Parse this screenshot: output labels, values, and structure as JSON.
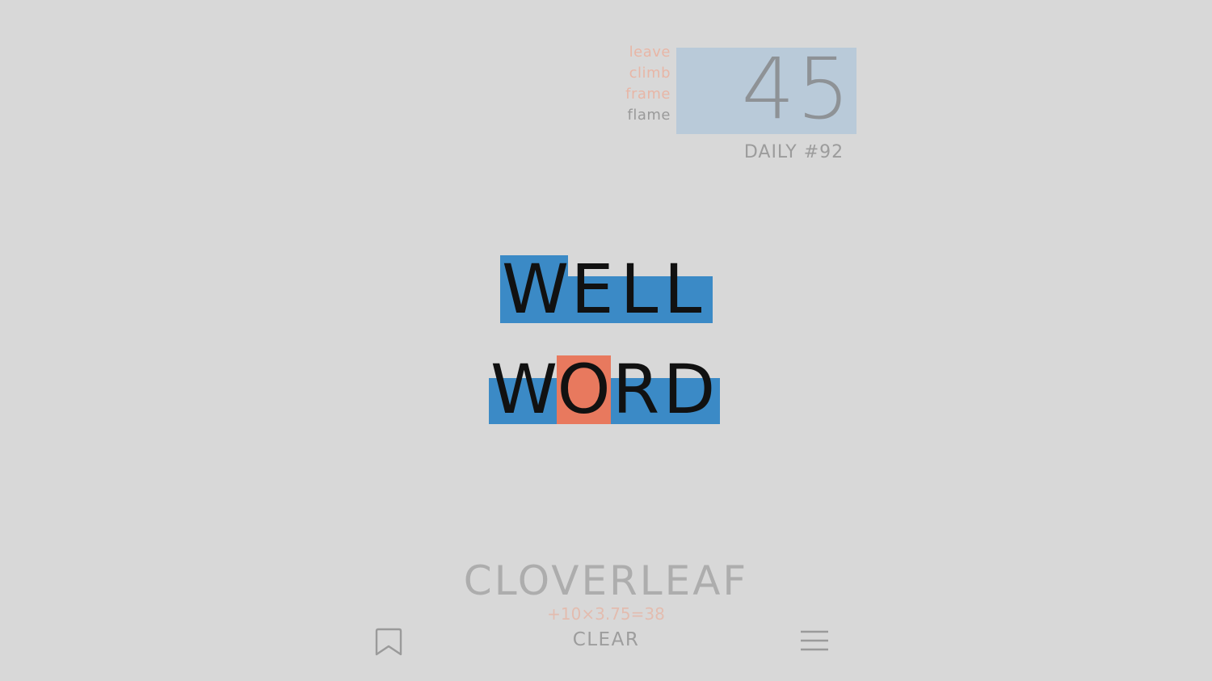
{
  "history": {
    "words": [
      {
        "text": "leave",
        "faded": true
      },
      {
        "text": "climb",
        "faded": true
      },
      {
        "text": "frame",
        "faded": true
      },
      {
        "text": "flame",
        "faded": false
      }
    ]
  },
  "score": {
    "value": "45",
    "daily_label": "DAILY #92"
  },
  "title": {
    "row1": [
      "W",
      "E",
      "L",
      "L"
    ],
    "row2": [
      "W",
      "O",
      "R",
      "D"
    ]
  },
  "bonus": {
    "word": "CLOVERLEAF",
    "formula": "+10×3.75=38"
  },
  "toolbar": {
    "clear_label": "CLEAR",
    "bookmark_icon": "bookmark-icon",
    "menu_icon": "menu-icon"
  },
  "colors": {
    "background": "#d8d8d8",
    "tile_blue": "#3b8ac6",
    "tile_orange": "#e8795e",
    "score_box": "#b9cad9",
    "faded_history": "#e8b6a6"
  }
}
